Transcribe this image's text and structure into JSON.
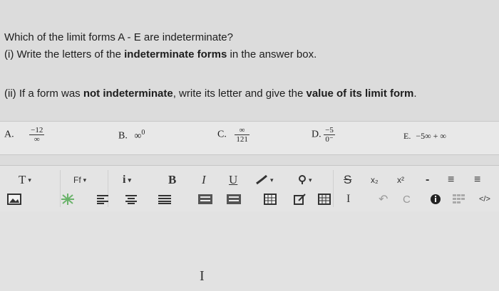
{
  "question": {
    "line1": "Which of the limit forms A - E are indeterminate?",
    "line2_prefix": "(i)  Write the letters of the ",
    "line2_bold": "indeterminate forms",
    "line2_suffix": " in the answer box.",
    "line3_prefix": "(ii)  If a form was ",
    "line3_bold1": "not indeterminate",
    "line3_mid": ", write its letter and give the ",
    "line3_bold2": "value of its limit form",
    "line3_end": "."
  },
  "options": {
    "a_label": "A.",
    "a_num": "−12",
    "a_den": "∞",
    "b_label": "B.",
    "b_base": "∞",
    "b_exp": "0",
    "c_label": "C.",
    "c_num": "∞",
    "c_den": "121",
    "d_label": "D.",
    "d_num": "−5",
    "d_den": "0⁻",
    "e_label": "E.",
    "e_expr": "−5∞ + ∞"
  },
  "toolbar": {
    "font_size": "T",
    "font_family": "Ff",
    "info": "i",
    "bold": "B",
    "italic": "I",
    "underline": "U",
    "strike": "S",
    "subscript": "x₂",
    "superscript": "x²",
    "dash": "-",
    "bullets": "≡",
    "numbering": "≡",
    "special_char": "I",
    "undo": "↶",
    "redo": "C",
    "code": "</>",
    "caret": "▾",
    "icons": [
      "image-icon",
      "sparkle-icon",
      "align-left-icon",
      "align-center-icon",
      "align-justify-icon",
      "indent-icon",
      "outdent-icon",
      "table-icon",
      "edit-icon",
      "grid-icon",
      "text-cursor-icon",
      "undo-icon",
      "redo-icon",
      "info-icon",
      "grid-small-icon",
      "code-icon"
    ]
  },
  "editor": {
    "cursor": "I"
  }
}
